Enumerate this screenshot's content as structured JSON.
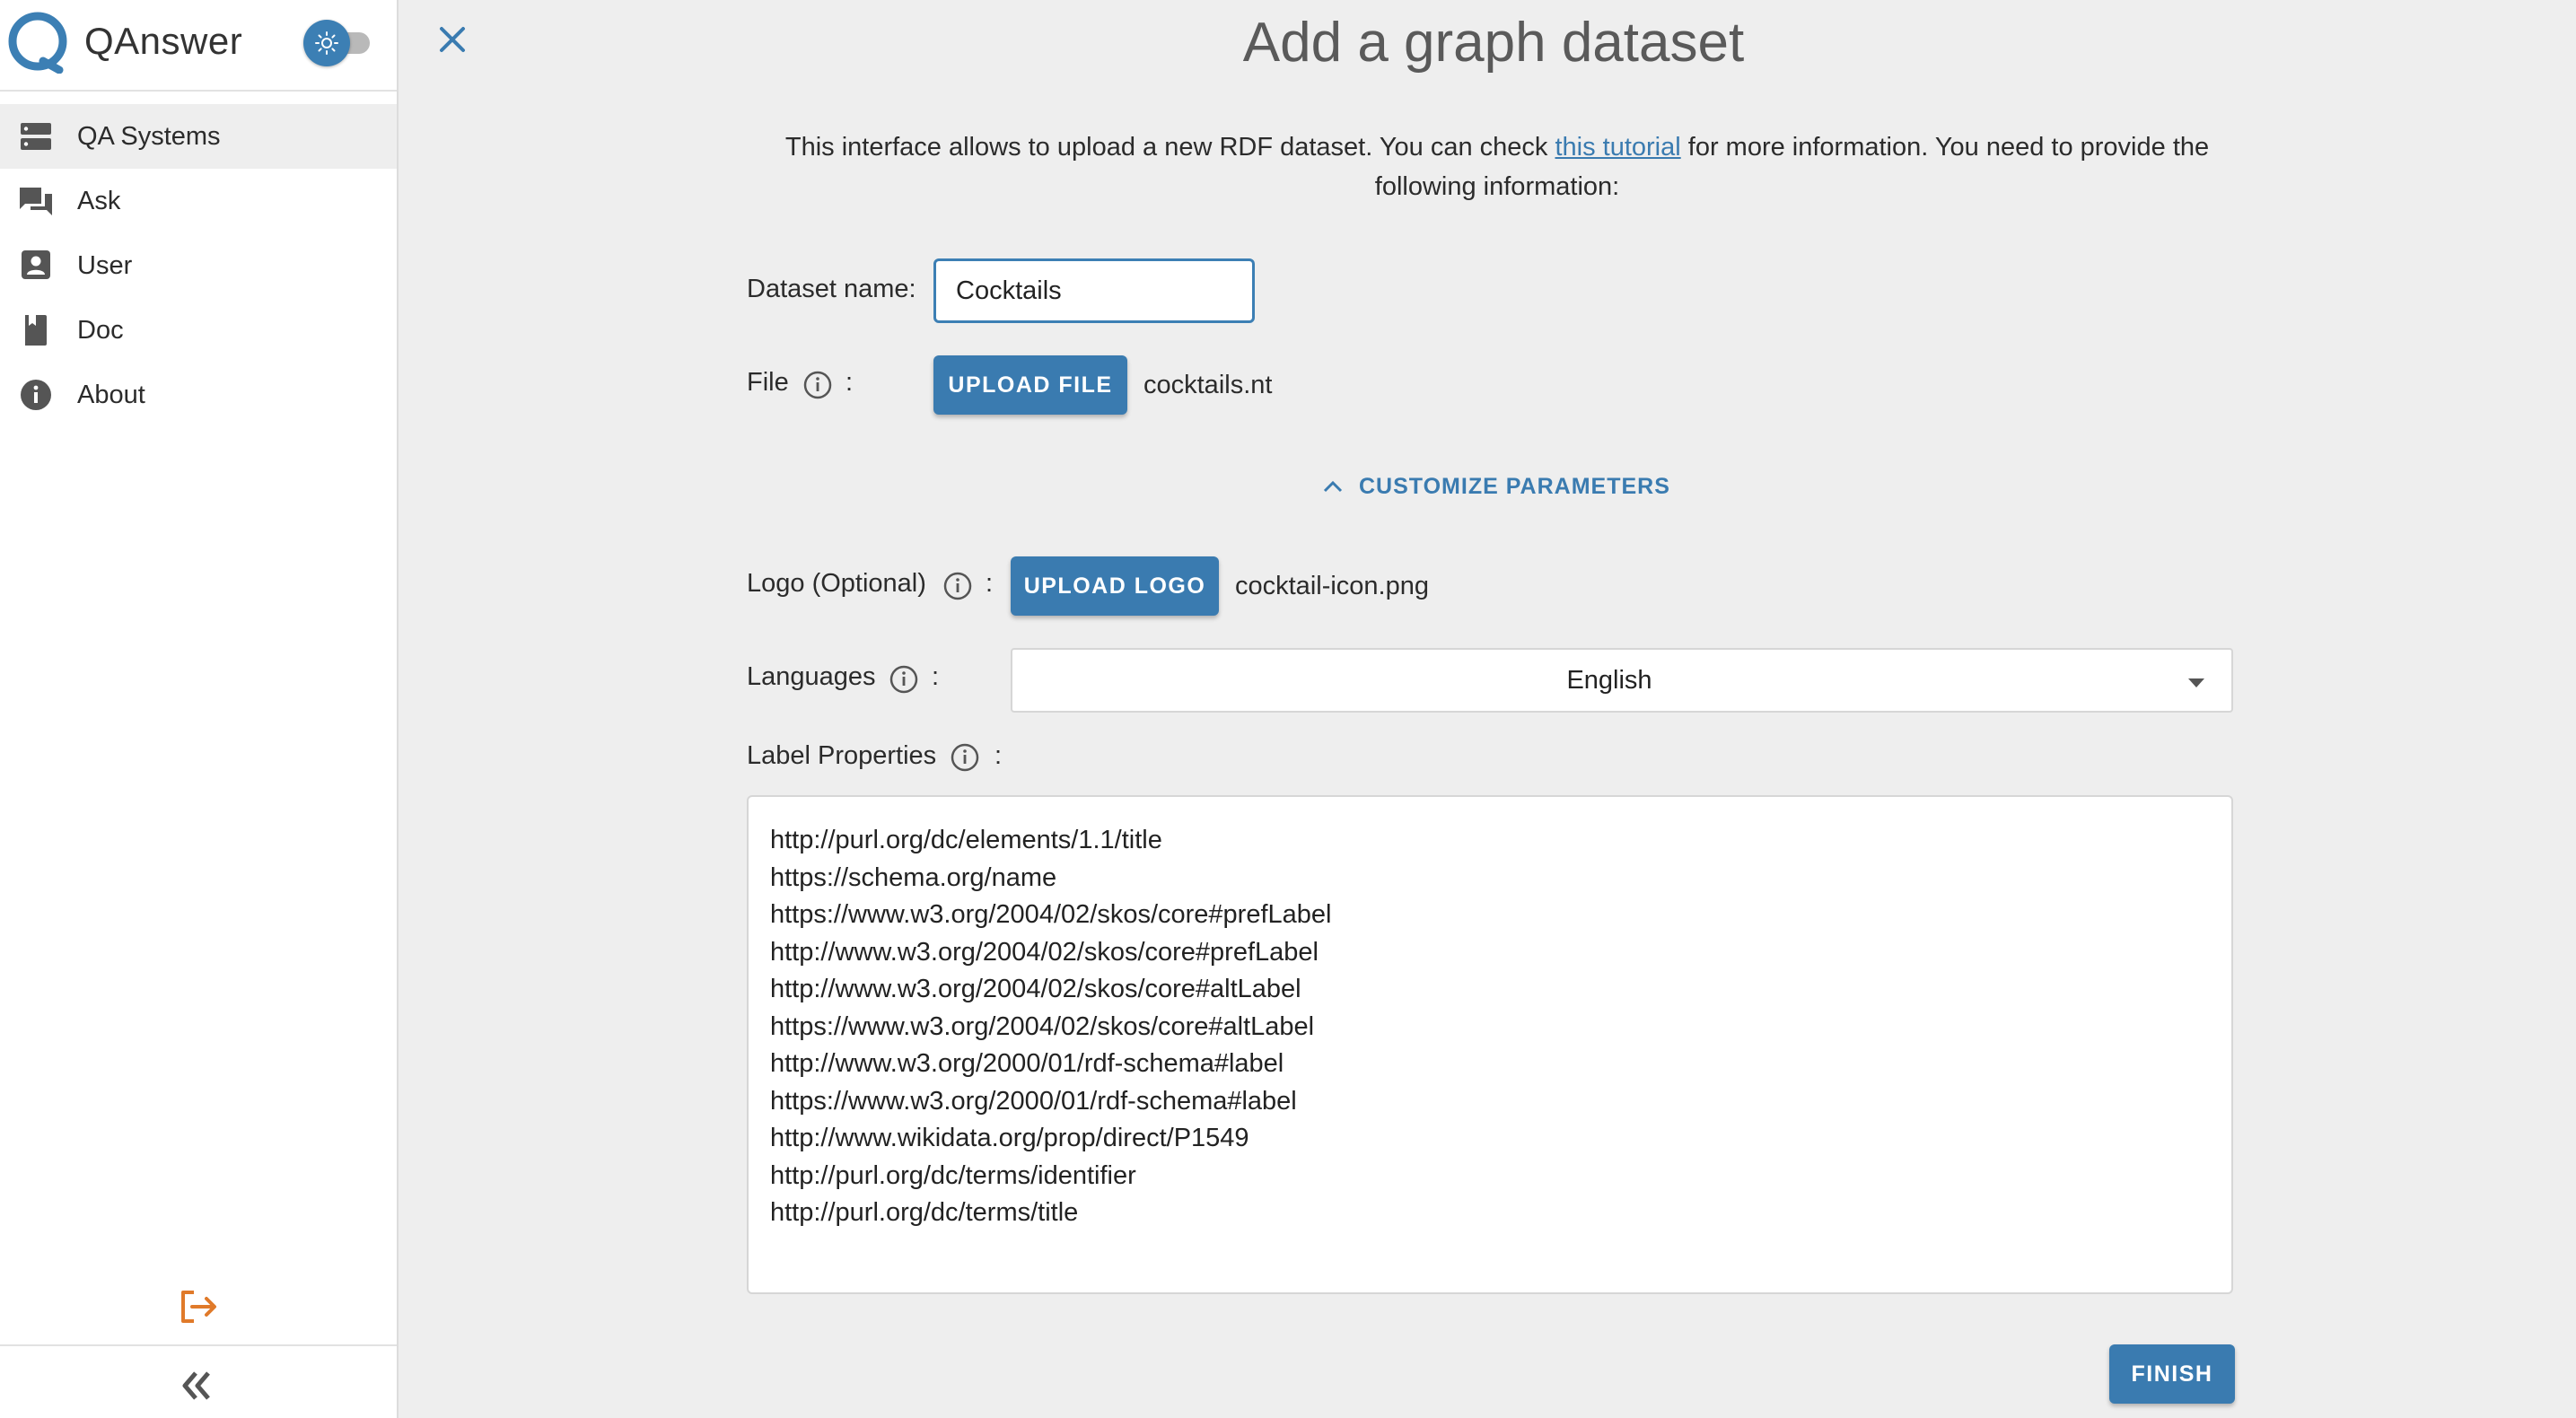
{
  "sidebar": {
    "brand": "QAnswer",
    "items": [
      {
        "label": "QA Systems",
        "icon": "server-icon"
      },
      {
        "label": "Ask",
        "icon": "chat-icon"
      },
      {
        "label": "User",
        "icon": "user-icon"
      },
      {
        "label": "Doc",
        "icon": "book-icon"
      },
      {
        "label": "About",
        "icon": "info-icon"
      }
    ]
  },
  "page": {
    "title": "Add a graph dataset",
    "intro_before": "This interface allows to upload a new RDF dataset. You can check ",
    "intro_link": "this tutorial",
    "intro_after": " for more information. You need to provide the following information:"
  },
  "form": {
    "dataset_name_label": "Dataset name:",
    "dataset_name_value": "Cocktails",
    "file_label": "File",
    "colon": ":",
    "upload_file_label": "UPLOAD FILE",
    "file_name": "cocktails.nt",
    "customize_label": "CUSTOMIZE PARAMETERS",
    "logo_label": "Logo (Optional)",
    "upload_logo_label": "UPLOAD LOGO",
    "logo_file_name": "cocktail-icon.png",
    "languages_label": "Languages",
    "languages_value": "English",
    "label_properties_label": "Label Properties",
    "label_properties_value": "http://purl.org/dc/elements/1.1/title\nhttps://schema.org/name\nhttps://www.w3.org/2004/02/skos/core#prefLabel\nhttp://www.w3.org/2004/02/skos/core#prefLabel\nhttp://www.w3.org/2004/02/skos/core#altLabel\nhttps://www.w3.org/2004/02/skos/core#altLabel\nhttp://www.w3.org/2000/01/rdf-schema#label\nhttps://www.w3.org/2000/01/rdf-schema#label\nhttp://www.wikidata.org/prop/direct/P1549\nhttp://purl.org/dc/terms/identifier\nhttp://purl.org/dc/terms/title",
    "finish_label": "FINISH"
  },
  "colors": {
    "accent": "#3a7bb0",
    "logout": "#e07a2a",
    "sidebar_active": "#eeeeee"
  }
}
